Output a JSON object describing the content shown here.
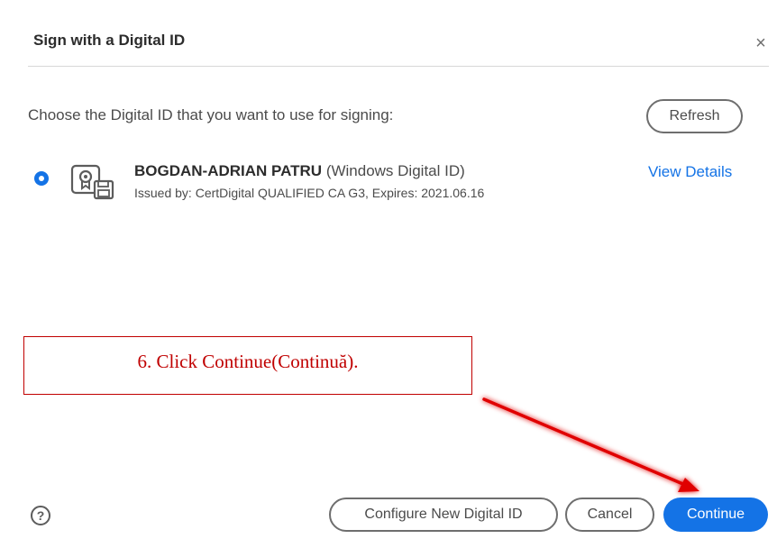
{
  "dialog": {
    "title": "Sign with a Digital ID",
    "close_symbol": "×",
    "prompt": "Choose the Digital ID that you want to use for signing:",
    "refresh_label": "Refresh"
  },
  "digital_id": {
    "name": "BOGDAN-ADRIAN PATRU",
    "type": "(Windows Digital ID)",
    "issued": "Issued by: CertDigital QUALIFIED CA G3, Expires: 2021.06.16",
    "view_details_label": "View Details",
    "icon": "certificate-id-icon",
    "selected": true
  },
  "annotation": {
    "callout_text": "6. Click Continue(Continuă).",
    "color": "#c00000"
  },
  "footer": {
    "help_symbol": "?",
    "configure_label": "Configure New Digital ID",
    "cancel_label": "Cancel",
    "continue_label": "Continue"
  },
  "colors": {
    "accent": "#1473e6",
    "text": "#4b4b4b"
  }
}
